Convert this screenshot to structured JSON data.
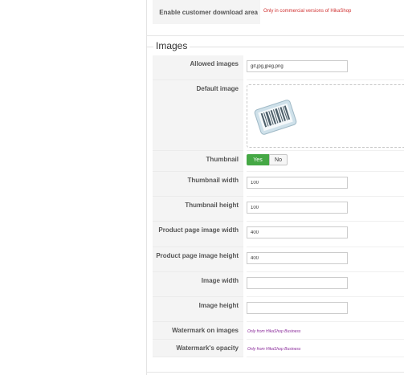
{
  "top_row": {
    "label": "Enable customer download area",
    "value": "Only in commercial versions of HikaShop"
  },
  "section": {
    "title": "Images"
  },
  "fields": {
    "allowed_images": {
      "label": "Allowed images",
      "value": "gif,jpg,jpeg,png"
    },
    "default_image": {
      "label": "Default image"
    },
    "thumbnail": {
      "label": "Thumbnail",
      "yes": "Yes",
      "no": "No",
      "selected": "Yes"
    },
    "thumbnail_width": {
      "label": "Thumbnail width",
      "value": "100"
    },
    "thumbnail_height": {
      "label": "Thumbnail height",
      "value": "100"
    },
    "product_page_image_width": {
      "label": "Product page image width",
      "value": "400"
    },
    "product_page_image_height": {
      "label": "Product page image height",
      "value": "400"
    },
    "image_width": {
      "label": "Image width",
      "value": ""
    },
    "image_height": {
      "label": "Image height",
      "value": ""
    },
    "watermark_on_images": {
      "label": "Watermark on images",
      "note": "Only from HikaShop Business"
    },
    "watermark_opacity": {
      "label": "Watermark's opacity",
      "note": "Only from HikaShop Business"
    }
  },
  "colors": {
    "toggle_active": "#45a845",
    "commercial_note": "#d03030",
    "business_note": "#8a2a9a"
  },
  "icons": {
    "default_image": "barcode-label-icon"
  }
}
